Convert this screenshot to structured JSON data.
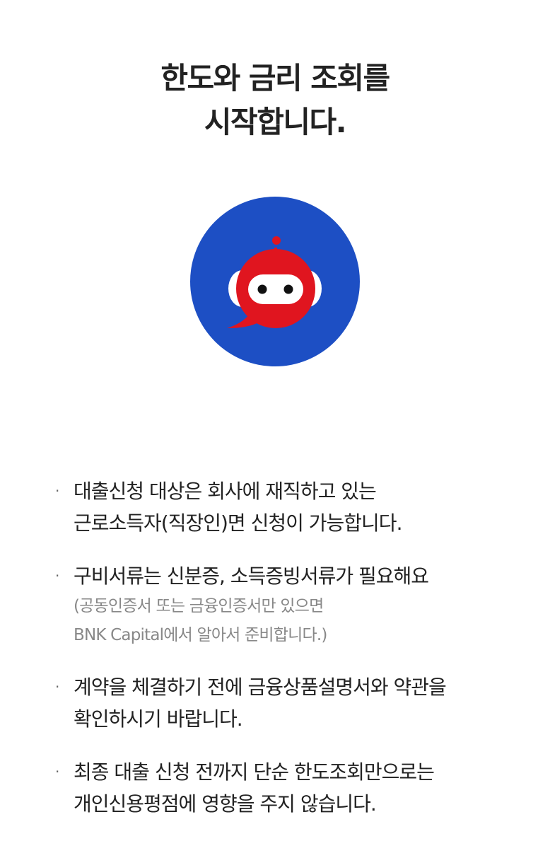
{
  "header": {
    "title_line1": "한도와 금리 조회를",
    "title_line2": "시작합니다."
  },
  "mascot": {
    "icon": "robot-chat-icon",
    "bg_color": "#1d4fc4",
    "head_color": "#e0151f"
  },
  "notes": [
    {
      "lines": [
        "대출신청 대상은 회사에 재직하고 있는",
        "근로소득자(직장인)면 신청이 가능합니다."
      ],
      "sub": []
    },
    {
      "lines": [
        "구비서류는 신분증, 소득증빙서류가 필요해요"
      ],
      "sub": [
        "(공동인증서 또는 금융인증서만 있으면",
        "BNK Capital에서 알아서 준비합니다.)"
      ]
    },
    {
      "lines": [
        "계약을 체결하기 전에 금융상품설명서와 약관을",
        "확인하시기 바랍니다."
      ],
      "sub": []
    },
    {
      "lines": [
        "최종 대출 신청 전까지 단순 한도조회만으로는",
        "개인신용평점에 영향을 주지 않습니다."
      ],
      "sub": []
    }
  ]
}
